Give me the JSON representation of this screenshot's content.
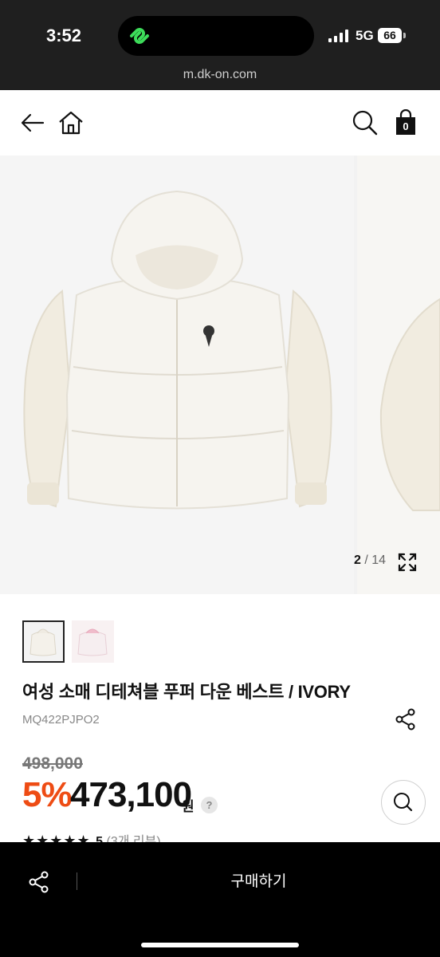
{
  "status_bar": {
    "time": "3:52",
    "network": "5G",
    "battery": "66"
  },
  "browser": {
    "url": "m.dk-on.com"
  },
  "header": {
    "cart_count": "0"
  },
  "gallery": {
    "current": "2",
    "separator": "/",
    "total": "14"
  },
  "product": {
    "title": "여성 소매 디테쳐블 푸퍼 다운 베스트 / IVORY",
    "sku": "MQ422PJPO2",
    "original_price": "498,000",
    "discount": "5%",
    "price": "473,100",
    "currency": "원",
    "help": "?",
    "rating": {
      "stars": "★★★★★",
      "score": "5",
      "reviews": "(3개 리뷰)"
    }
  },
  "bottom_bar": {
    "buy_label": "구매하기"
  },
  "colors": {
    "discount": "#ee4c14",
    "bar": "#000000",
    "status_bg": "#1f1f1f"
  }
}
